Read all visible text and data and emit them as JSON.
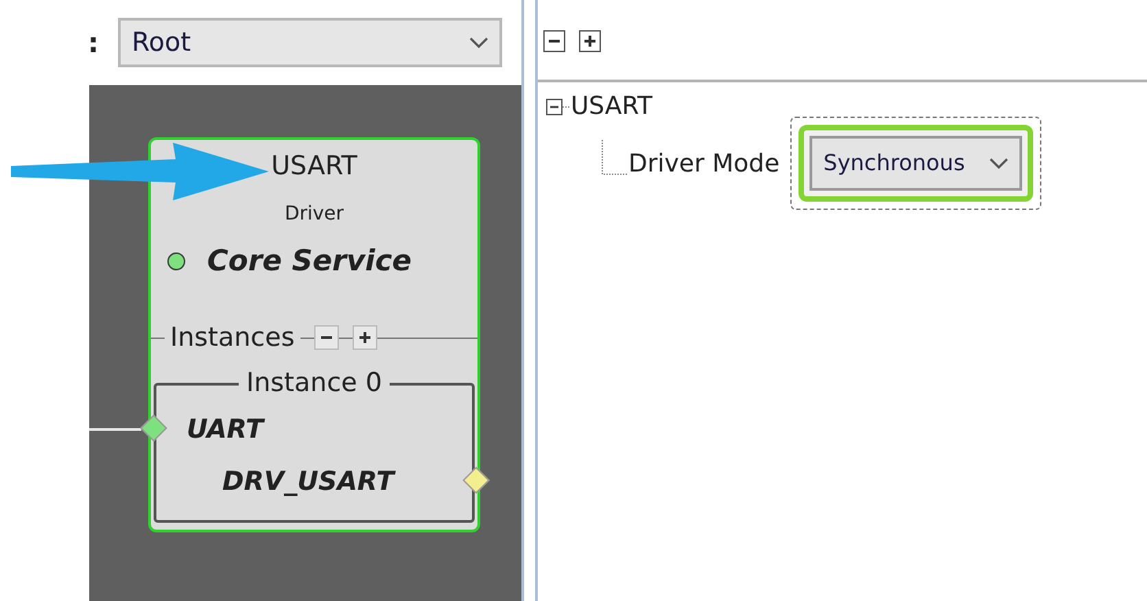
{
  "left_panel": {
    "label": ":",
    "dropdown": {
      "value": "Root"
    }
  },
  "canvas": {
    "component": {
      "title": "USART",
      "subtitle": "Driver",
      "service": {
        "label": "Core Service",
        "color": "#7ee07e"
      },
      "instances_label": "Instances",
      "instance": {
        "label": "Instance 0",
        "inputs": [
          {
            "label": "UART",
            "color": "#7ee07e"
          }
        ],
        "outputs": [
          {
            "label": "DRV_USART",
            "color": "#f5ee90"
          }
        ]
      }
    }
  },
  "right_panel": {
    "tree": [
      {
        "label": "USART",
        "expanded": true,
        "children": [
          {
            "label": "Driver Mode",
            "value": "Synchronous",
            "highlighted": true
          }
        ]
      }
    ]
  }
}
